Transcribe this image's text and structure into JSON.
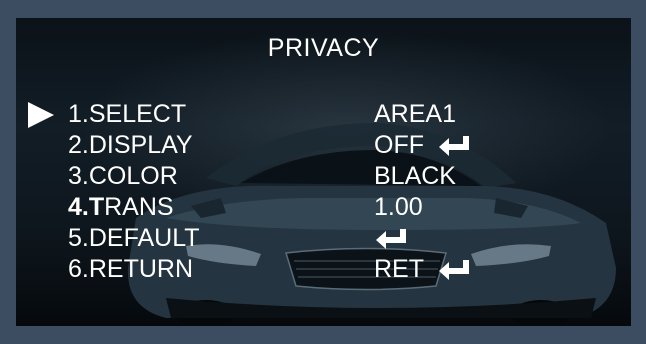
{
  "menu_title": "PRIVACY",
  "items": [
    {
      "number": "1.",
      "label": "SELECT",
      "value": "AREA1",
      "enter": false,
      "selected": true
    },
    {
      "number": "2.",
      "label": "DISPLAY",
      "value": "OFF",
      "enter": true,
      "selected": false
    },
    {
      "number": "3.",
      "label": "COLOR",
      "value": "BLACK",
      "enter": false,
      "selected": false
    },
    {
      "number_bold": "4.T",
      "label": "RANS",
      "value": "1.00",
      "enter": false,
      "selected": false
    },
    {
      "number": "5.",
      "label": "DEFAULT",
      "value": "",
      "enter": true,
      "selected": false
    },
    {
      "number": "6.",
      "label": "RETURN",
      "value": "RET",
      "enter": true,
      "selected": false
    }
  ],
  "colors": {
    "frame": "#3c4d61",
    "text": "#ffffff"
  },
  "icons": {
    "cursor": "right-triangle-cursor-icon",
    "enter": "enter-return-arrow-icon"
  }
}
